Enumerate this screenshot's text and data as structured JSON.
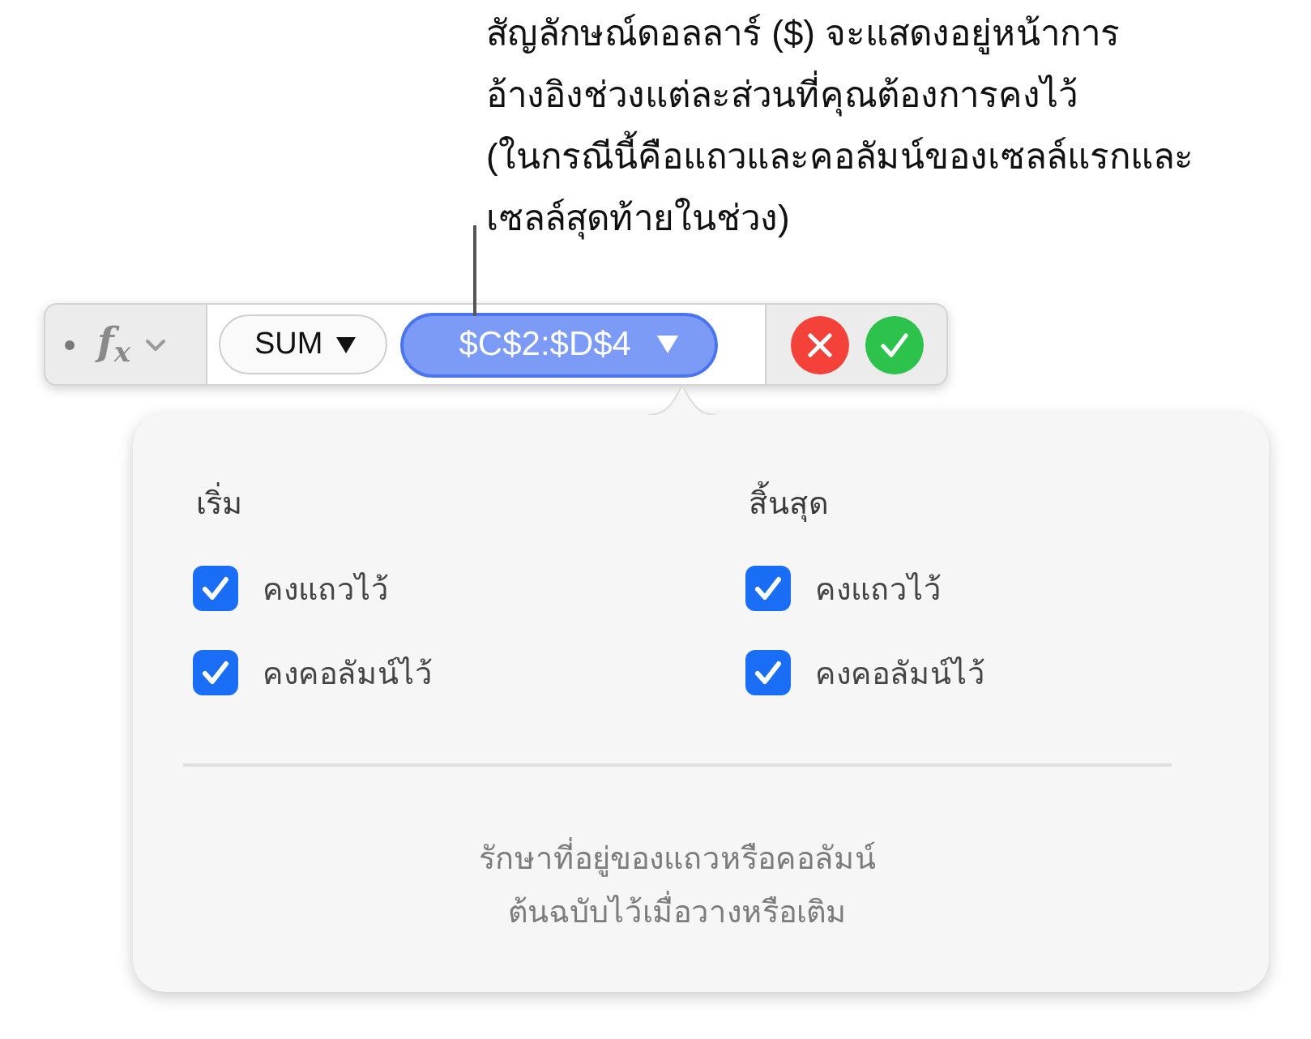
{
  "callout": {
    "lines": [
      "สัญลักษณ์ดอลลาร์ ($) จะแสดงอยู่หน้าการ",
      "อ้างอิงช่วงแต่ละส่วนที่คุณต้องการคงไว้",
      "(ในกรณีนี้คือแถวและคอลัมน์ของเซลล์แรกและ",
      "เซลล์สุดท้ายในช่วง)"
    ]
  },
  "formula_bar": {
    "function_symbol": "f$_{x}$",
    "tokens": [
      {
        "label": "SUM",
        "selected": false
      },
      {
        "label": "$C$2:$D$4",
        "selected": true
      }
    ]
  },
  "popover": {
    "columns": [
      {
        "heading": "เริ่ม",
        "options": [
          {
            "label": "คงแถวไว้",
            "checked": true
          },
          {
            "label": "คงคอลัมน์ไว้",
            "checked": true
          }
        ]
      },
      {
        "heading": "สิ้นสุด",
        "options": [
          {
            "label": "คงแถวไว้",
            "checked": true
          },
          {
            "label": "คงคอลัมน์ไว้",
            "checked": true
          }
        ]
      }
    ],
    "note": {
      "lines": [
        "รักษาที่อยู่ของแถวหรือคอลัมน์",
        "ต้นฉบับไว้เมื่อวางหรือเติม"
      ]
    }
  }
}
